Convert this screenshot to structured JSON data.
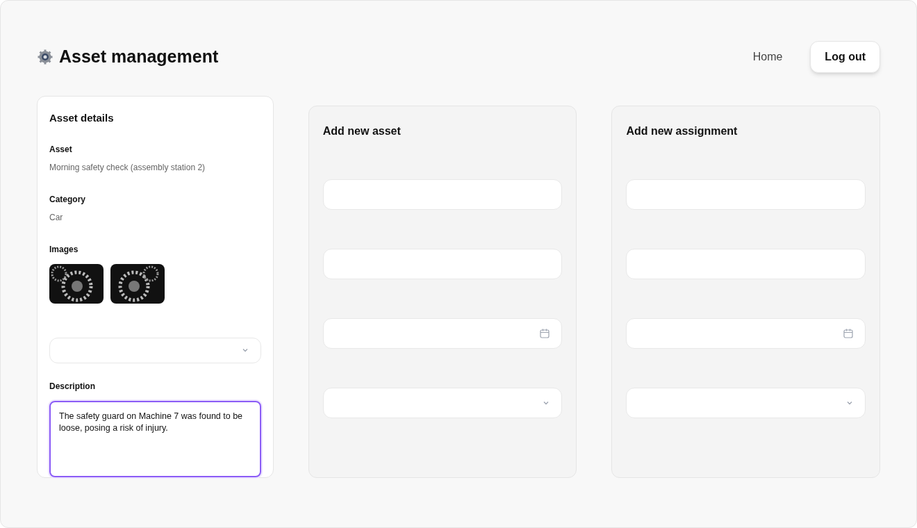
{
  "header": {
    "title": "Asset management",
    "nav": [
      {
        "kind": "link",
        "label": "Home"
      },
      {
        "kind": "button",
        "label": "Log out"
      }
    ]
  },
  "details": {
    "title": "Asset details",
    "asset": {
      "label": "Asset",
      "value": "Morning safety check (assembly station 2)"
    },
    "category": {
      "label": "Category",
      "value": "Car"
    },
    "images": {
      "label": "Images",
      "items": [
        {
          "kind": "photo"
        },
        {
          "kind": "photo"
        }
      ]
    },
    "select": {
      "kind": "select"
    },
    "description": {
      "label": "Description",
      "value": "The safety guard on Machine 7 was found to be loose, posing a risk of injury.",
      "focused": true
    }
  },
  "panels": [
    {
      "title": "Add new asset",
      "fields": [
        {
          "kind": "text"
        },
        {
          "kind": "text"
        },
        {
          "kind": "date"
        },
        {
          "kind": "select"
        }
      ]
    },
    {
      "title": "Add new assignment",
      "fields": [
        {
          "kind": "text"
        },
        {
          "kind": "text"
        },
        {
          "kind": "date"
        },
        {
          "kind": "select"
        }
      ]
    }
  ]
}
